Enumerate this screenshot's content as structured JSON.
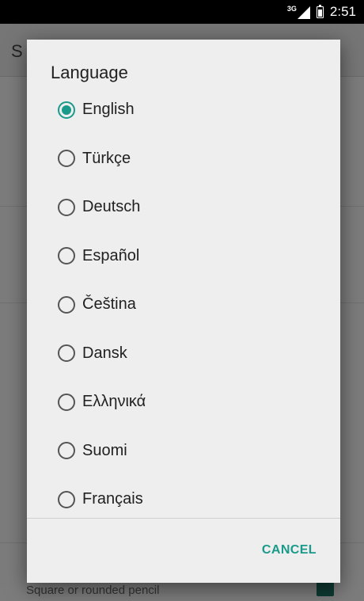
{
  "status_bar": {
    "network": "3G",
    "time": "2:51"
  },
  "background": {
    "title_initial": "S",
    "subtitle": "Square or rounded pencil"
  },
  "dialog": {
    "title": "Language",
    "selected_index": 0,
    "options": [
      "English",
      "Türkçe",
      "Deutsch",
      "Español",
      "Čeština",
      "Dansk",
      "Ελληνικά",
      "Suomi",
      "Français"
    ],
    "cancel_label": "CANCEL"
  },
  "colors": {
    "accent": "#1a9a8a",
    "dialog_bg": "#eeeeee",
    "status_bar": "#000000"
  }
}
